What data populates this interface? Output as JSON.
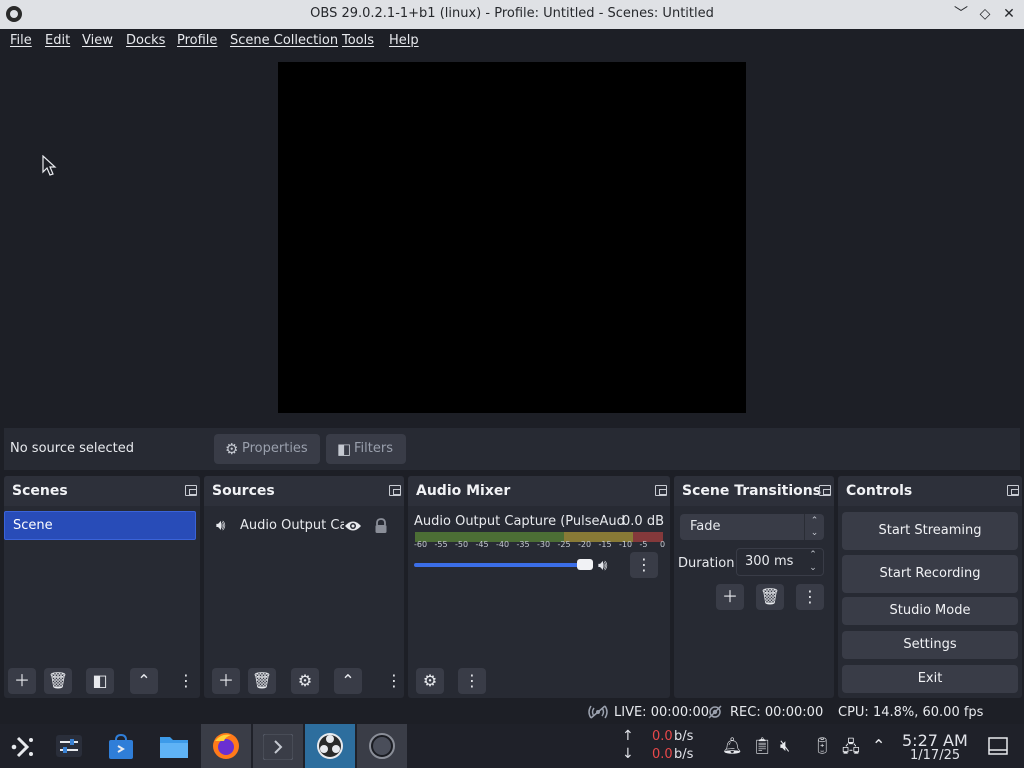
{
  "window": {
    "title": "OBS 29.0.2.1-1+b1 (linux) - Profile: Untitled - Scenes: Untitled",
    "btn_minimize": "﹀",
    "btn_maximize": "◇",
    "btn_close": "✕"
  },
  "menu": [
    "File",
    "Edit",
    "View",
    "Docks",
    "Profile",
    "Scene Collection",
    "Tools",
    "Help"
  ],
  "source_toolbar": {
    "status": "No source selected",
    "properties": "Properties",
    "filters": "Filters"
  },
  "docks": {
    "scenes": {
      "title": "Scenes",
      "items": [
        "Scene"
      ]
    },
    "sources": {
      "title": "Sources",
      "items": [
        {
          "name": "Audio Output Ca",
          "icon": "speaker-icon"
        }
      ]
    },
    "mixer": {
      "title": "Audio Mixer",
      "channel": "Audio Output Capture (PulseAudio)",
      "db": "0.0 dB",
      "ticks": [
        "-60",
        "-55",
        "-50",
        "-45",
        "-40",
        "-35",
        "-30",
        "-25",
        "-20",
        "-15",
        "-10",
        "-5",
        "0"
      ],
      "volume_fraction": 0.95
    },
    "transitions": {
      "title": "Scene Transitions",
      "selected": "Fade",
      "duration_label": "Duration",
      "duration_value": "300 ms"
    },
    "controls": {
      "title": "Controls",
      "start_streaming": "Start Streaming",
      "start_recording": "Start Recording",
      "studio_mode": "Studio Mode",
      "settings": "Settings",
      "exit": "Exit"
    }
  },
  "status": {
    "live": "LIVE: 00:00:00",
    "rec": "REC: 00:00:00",
    "cpu": "CPU: 14.8%, 60.00 fps"
  },
  "taskbar": {
    "upload_rate": "0.0",
    "download_rate": "0.0",
    "rate_unit": "b/s",
    "time": "5:27 AM",
    "date": "1/17/25"
  },
  "colors": {
    "accent": "#284cb8",
    "rate_red": "#e8484a"
  }
}
